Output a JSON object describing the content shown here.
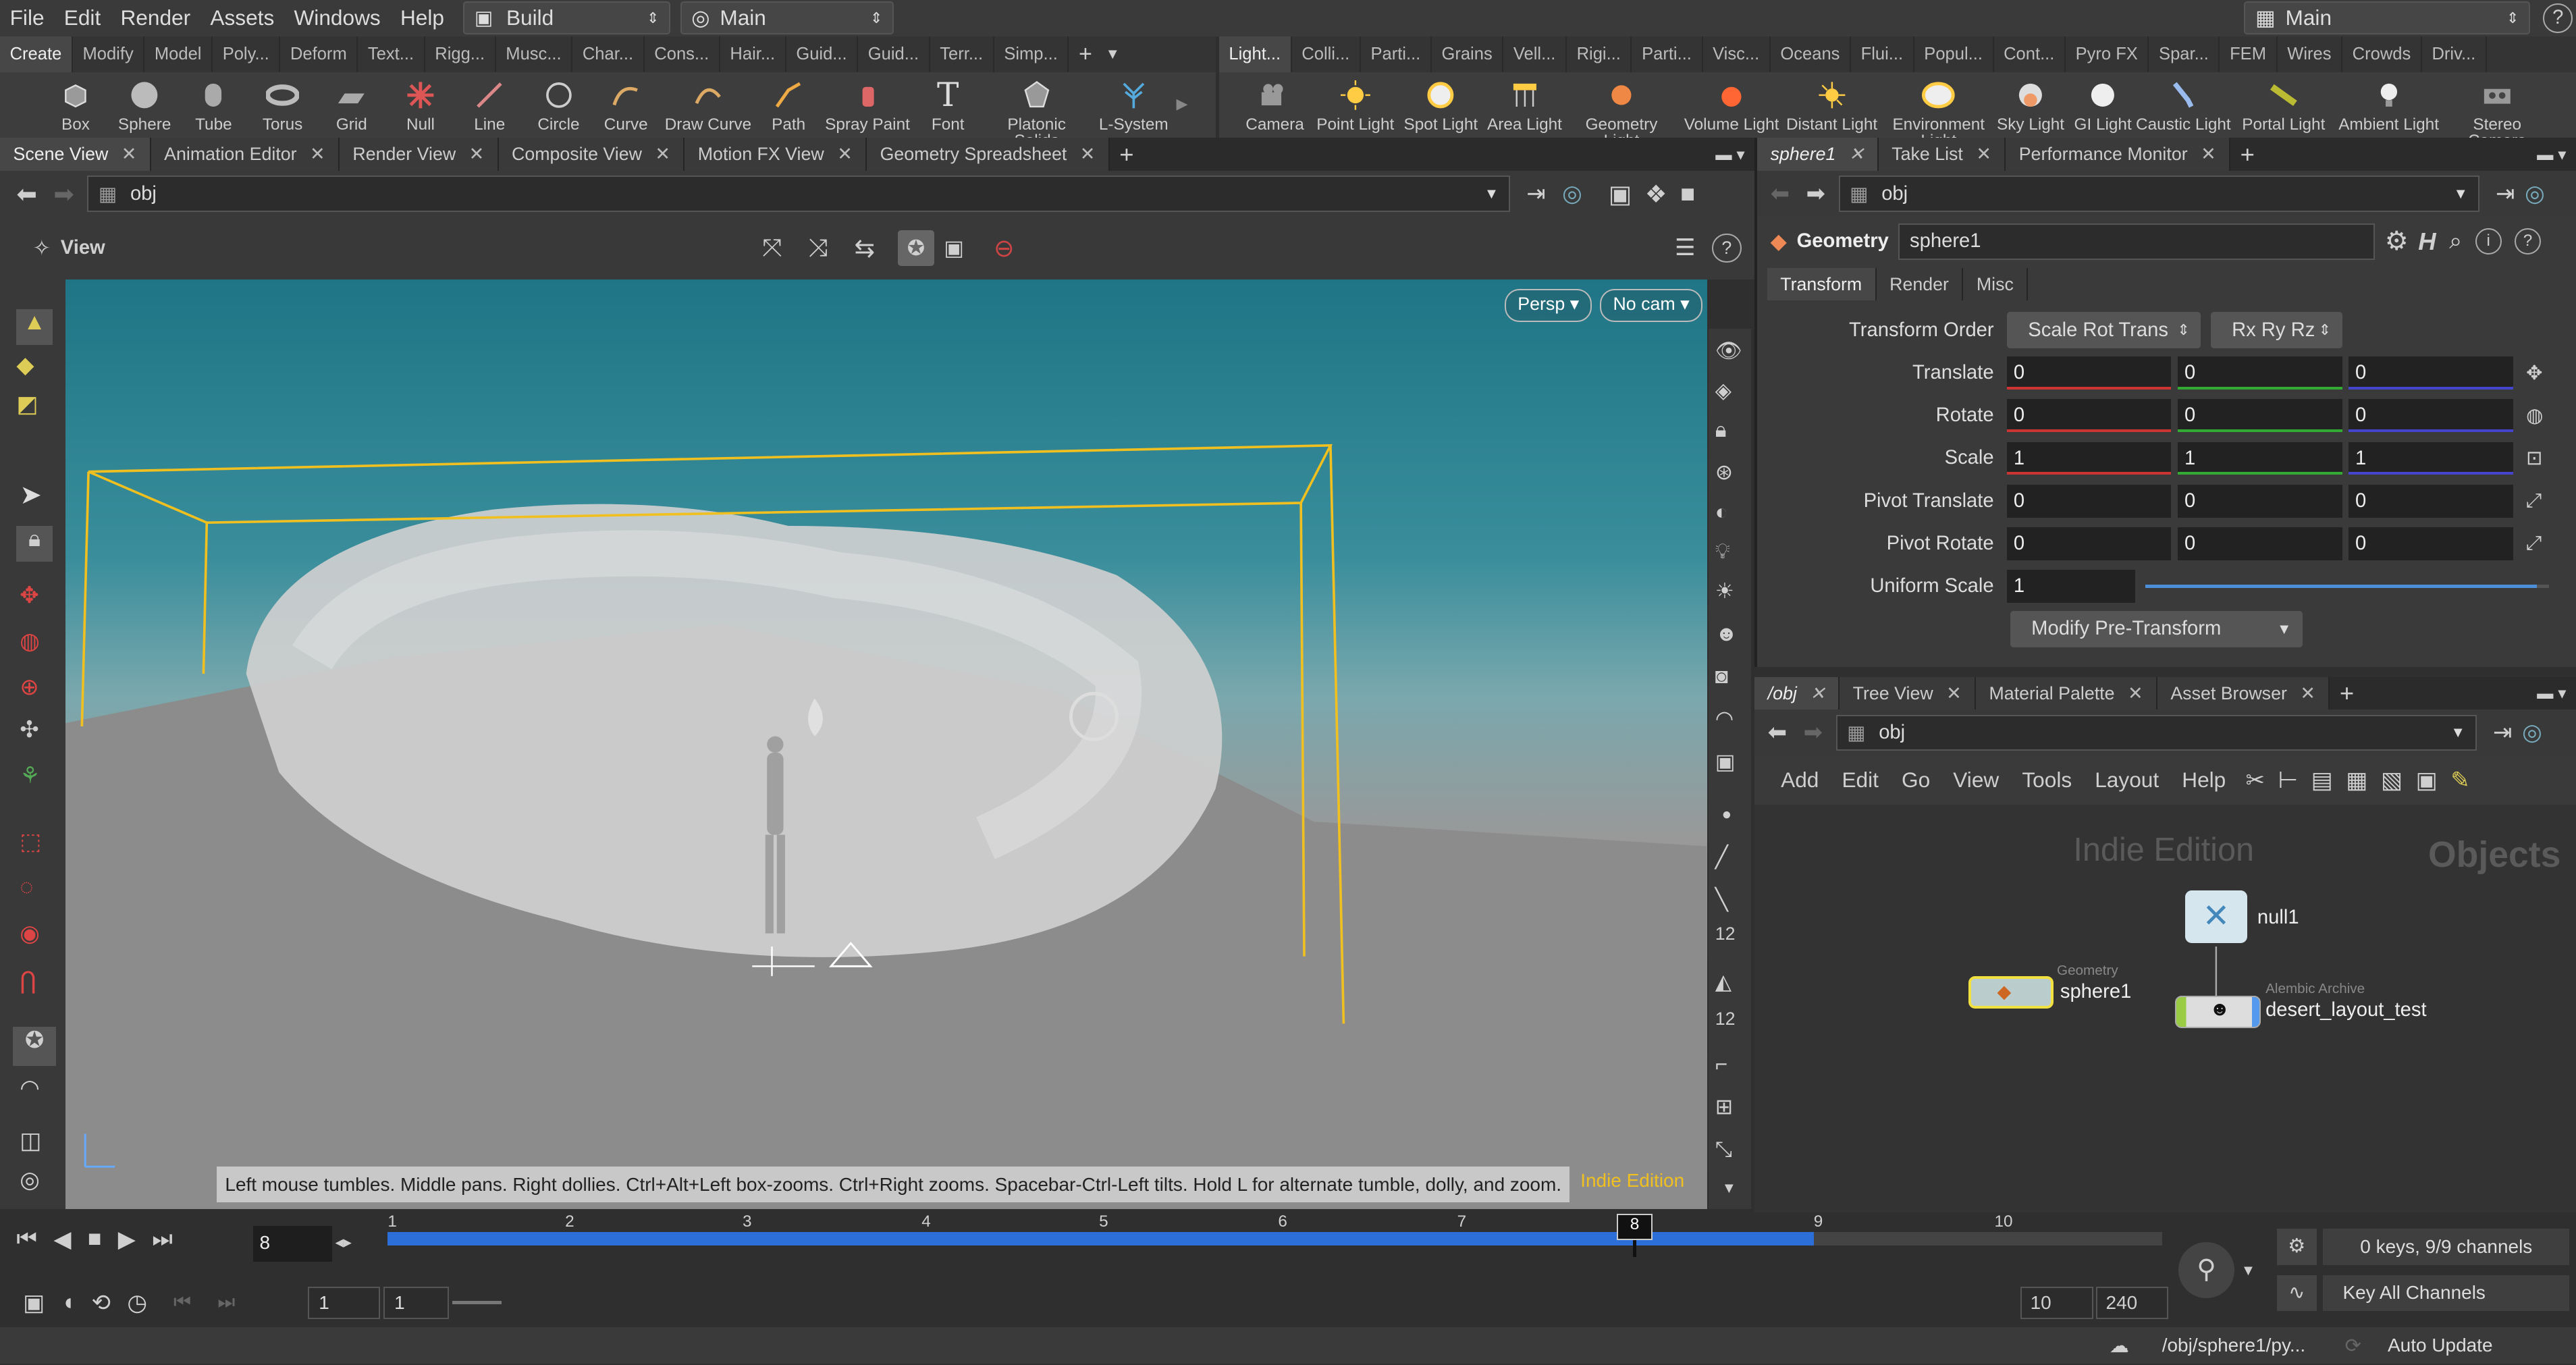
{
  "menu": {
    "items": [
      "File",
      "Edit",
      "Render",
      "Assets",
      "Windows",
      "Help"
    ],
    "desktop": "Build",
    "context": "Main",
    "right_desktop": "Main"
  },
  "shelf_left": {
    "tabs": [
      "Create",
      "Modify",
      "Model",
      "Poly...",
      "Deform",
      "Text...",
      "Rigg...",
      "Musc...",
      "Char...",
      "Cons...",
      "Hair...",
      "Guid...",
      "Guid...",
      "Terr...",
      "Simp..."
    ],
    "tools": [
      "Box",
      "Sphere",
      "Tube",
      "Torus",
      "Grid",
      "Null",
      "Line",
      "Circle",
      "Curve",
      "Draw Curve",
      "Path",
      "Spray Paint",
      "Font",
      "Platonic Solids",
      "L-System"
    ]
  },
  "shelf_right": {
    "tabs": [
      "Light...",
      "Colli...",
      "Parti...",
      "Grains",
      "Vell...",
      "Rigi...",
      "Parti...",
      "Visc...",
      "Oceans",
      "Flui...",
      "Popul...",
      "Cont...",
      "Pyro FX",
      "Spar...",
      "FEM",
      "Wires",
      "Crowds",
      "Driv..."
    ],
    "tools": [
      "Camera",
      "Point Light",
      "Spot Light",
      "Area Light",
      "Geometry Light",
      "Volume Light",
      "Distant Light",
      "Environment Light",
      "Sky Light",
      "GI Light",
      "Caustic Light",
      "Portal Light",
      "Ambient Light",
      "Stereo Camera"
    ]
  },
  "left_pane": {
    "tabs": [
      "Scene View",
      "Animation Editor",
      "Render View",
      "Composite View",
      "Motion FX View",
      "Geometry Spreadsheet"
    ],
    "path": "obj",
    "view_label": "View",
    "persp": "Persp",
    "cam": "No cam",
    "hint": "Left mouse tumbles. Middle pans. Right dollies. Ctrl+Alt+Left box-zooms. Ctrl+Right zooms. Spacebar-Ctrl-Left tilts. Hold L for alternate tumble, dolly, and zoom.",
    "edition": "Indie Edition",
    "side_num1": "12",
    "side_num2": "12"
  },
  "params": {
    "tabs": [
      "sphere1",
      "Take List",
      "Performance Monitor"
    ],
    "path": "obj",
    "type_label": "Geometry",
    "node_name": "sphere1",
    "sub_tabs": [
      "Transform",
      "Render",
      "Misc"
    ],
    "transform_order_label": "Transform Order",
    "transform_order": "Scale Rot Trans",
    "rot_order": "Rx Ry Rz",
    "rows": [
      {
        "label": "Translate",
        "v": [
          "0",
          "0",
          "0"
        ]
      },
      {
        "label": "Rotate",
        "v": [
          "0",
          "0",
          "0"
        ]
      },
      {
        "label": "Scale",
        "v": [
          "1",
          "1",
          "1"
        ]
      },
      {
        "label": "Pivot Translate",
        "v": [
          "0",
          "0",
          "0"
        ]
      },
      {
        "label": "Pivot Rotate",
        "v": [
          "0",
          "0",
          "0"
        ]
      }
    ],
    "uniform_scale_label": "Uniform Scale",
    "uniform_scale": "1",
    "uniform_scale_level": 0.97,
    "modify_pre": "Modify Pre-Transform"
  },
  "network": {
    "tabs": [
      "/obj",
      "Tree View",
      "Material Palette",
      "Asset Browser"
    ],
    "path": "obj",
    "menu": [
      "Add",
      "Edit",
      "Go",
      "View",
      "Tools",
      "Layout",
      "Help"
    ],
    "watermark": "Indie Edition",
    "context": "Objects",
    "nodes": {
      "null": "null1",
      "geo_type": "Geometry",
      "geo": "sphere1",
      "abc_type": "Alembic Archive",
      "abc": "desert_layout_test"
    }
  },
  "timeline": {
    "current_frame": "8",
    "ticks": [
      "1",
      "2",
      "3",
      "4",
      "5",
      "6",
      "7",
      "8",
      "9",
      "10"
    ],
    "marker": "8",
    "start": "1",
    "start2": "1",
    "end": "10",
    "end2": "240",
    "keys_info": "0 keys, 9/9 channels",
    "key_all": "Key All Channels"
  },
  "status": {
    "path": "/obj/sphere1/py...",
    "update": "Auto Update"
  }
}
